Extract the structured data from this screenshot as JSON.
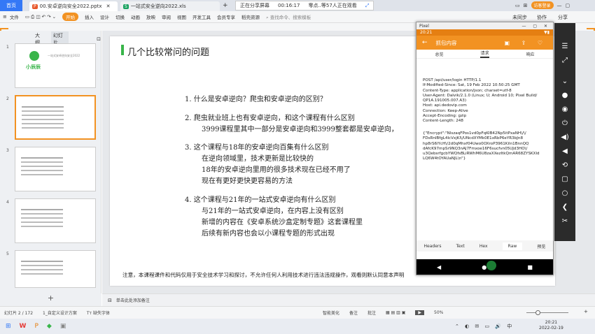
{
  "tabs": {
    "home": "首页",
    "file1": "00.安卓逆向安全2022.pptx",
    "file2": "一站式安全逆向2022.xls"
  },
  "share": {
    "status": "正在分享屏幕",
    "timer": "00:16:17",
    "viewers": "零点..等57人正在观看"
  },
  "account": {
    "login": "访客登录"
  },
  "ribbon": {
    "file": "文件",
    "start": "开始",
    "items": [
      "插入",
      "设计",
      "切换",
      "动画",
      "放映",
      "审阅",
      "视图",
      "开发工具",
      "会员专享",
      "稻壳资源"
    ],
    "search": "查找命令、搜索模板",
    "unsync": "未同步",
    "collab": "协作",
    "share": "分享"
  },
  "leftpane": {
    "outline": "大纲",
    "slides": "幻灯片",
    "nums": [
      "1",
      "2",
      "3",
      "4",
      "5"
    ],
    "thumb1_title": "小辰辰",
    "thumb1_sub": "一站式安卓逆向安全2022"
  },
  "slide": {
    "title": "几个比较常问的问题",
    "q1": "1.  什么是安卓逆向？爬虫和安卓逆向的区别？",
    "q2a": "2.  爬虫就业班上也有安卓逆向，和这个课程有什么区别",
    "q2b": "3999课程里其中一部分是安卓逆向和3999整套都是安卓逆向，",
    "q3a": "3.  这个课程与18年的安卓逆向百集有什么区别",
    "q3b": "在逆向领域里，技术更新是比较快的",
    "q3c": "18年的安卓逆向里用的很多技术现在已经不用了",
    "q3d": "现在有更好更快更容易的方法",
    "q4a": "4.  这个课程与21年的一站式安卓逆向有什么区别",
    "q4b": "与21年的一站式安卓逆向，在内容上没有区别",
    "q4c": "新增的内容在《安卓系统沙盒定制专题》这套课程里",
    "q4d": "后续有新内容也会以小课程专题的形式出现",
    "note": "注意，本课程课件和代码仅用于安全技术学习和探讨，不允许任何人利用技术进行违法违规操作，观看则默认同意本声明"
  },
  "phone": {
    "window_title": "Pixel",
    "time": "20:21",
    "header": "抓包内容",
    "tabs": [
      "总览",
      "请求",
      "响应"
    ],
    "req_lines": [
      "POST /api/user/login HTTP/1.1",
      "If-Modified-Since: Sat, 19 Feb 2022 10:50:25 GMT",
      "Content-Type: application/json; charset=utf-8",
      "User-Agent: Dalvik/2.1.0 (Linux; U; Android 10; Pixel Build/",
      "QP1A.191005.007.A3)",
      "Host: api.dedovip.com",
      "Connection: Keep-Alive",
      "Accept-Encoding: gzip",
      "Content-Length: 248"
    ],
    "body_lines": [
      "{\"Encrypt\":\"NlszaqFPos1vd0pFqKIB42Np5itPxaNH\\/\\/",
      "FDsRnlBfgL4lcVxjKI\\/UNcdXYMk0E1xRbP6eYR3bJn8",
      "hp8rS6lYcH\\/2d0qMhxf04Uwo0OXroP3961Kiln1BnnQQ",
      "dAfcK97mpSr9NQ3nAJ7Fmxoe16F6sucfvn05UJd3HO\\/",
      "u3QebsrfgcbYWQfsBLiRWhM6U8zaXXezltkQmAR68ZYSKXld",
      "LQ6W4tOYAUaNJL\\n\"}"
    ],
    "bottom_tabs": [
      "Headers",
      "Text",
      "Hex",
      "Raw",
      "预览"
    ]
  },
  "status": {
    "slide_counter": "幻灯片 2 / 172",
    "theme": "1_自定义设计方案",
    "missing_font": "缺失字体",
    "smart_beautify": "智能美化",
    "notes": "备注",
    "comments": "批注",
    "zoom": "50%",
    "notes_placeholder": "单击此处添加备注"
  },
  "taskbar": {
    "time": "20:21",
    "date": "2022-02-19"
  }
}
